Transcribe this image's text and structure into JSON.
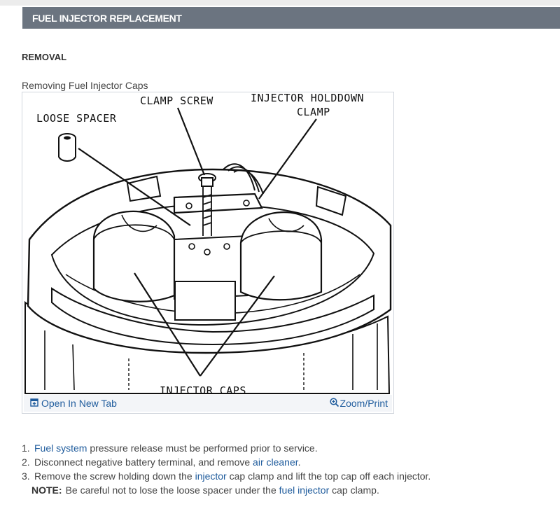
{
  "header": {
    "title": "FUEL INJECTOR REPLACEMENT"
  },
  "section": {
    "title": "REMOVAL"
  },
  "figure": {
    "caption": "Removing Fuel Injector Caps",
    "labels": {
      "clamp_screw": "CLAMP SCREW",
      "holddown_line1": "INJECTOR HOLDDOWN",
      "holddown_line2": "CLAMP",
      "loose_spacer": "LOOSE SPACER",
      "injector_caps": "INJECTOR CAPS"
    },
    "open_tab_label": "Open In New Tab",
    "open_tab_icon": "open-in-new-tab-icon",
    "zoom_label": "Zoom/Print",
    "zoom_icon": "zoom-in-icon"
  },
  "steps": [
    {
      "num": "1.",
      "link": "Fuel system",
      "text_after": " pressure release must be performed prior to service."
    },
    {
      "num": "2.",
      "text_before": "Disconnect negative battery terminal, and remove ",
      "link": "air cleaner",
      "text_after": "."
    },
    {
      "num": "3.",
      "text_before": "Remove the screw holding down the ",
      "link": "injector",
      "text_after": " cap clamp and lift the top cap off each injector."
    }
  ],
  "note": {
    "label": "NOTE:",
    "text_before": "Be careful not to lose the loose spacer under the ",
    "link": "fuel injector",
    "text_after": " cap clamp."
  },
  "colors": {
    "header_bg": "#6b7480",
    "link": "#1e5b9c",
    "footer_bg": "#f3f5f8"
  }
}
